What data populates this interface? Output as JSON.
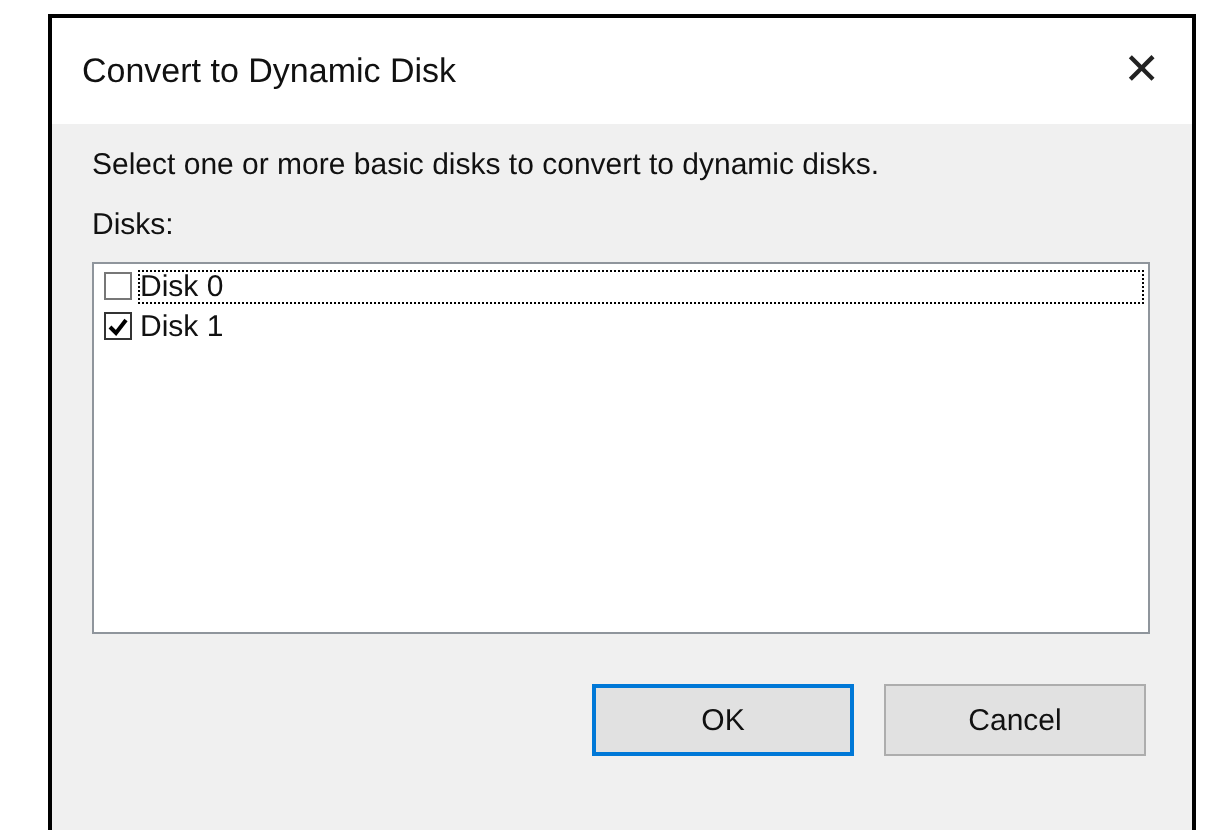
{
  "window": {
    "title": "Convert to Dynamic Disk",
    "close": "✕"
  },
  "instruction": "Select one or more basic disks to convert to dynamic disks.",
  "list_label": "Disks:",
  "disks": [
    {
      "label": "Disk 0",
      "checked": false,
      "focused": true
    },
    {
      "label": "Disk 1",
      "checked": true,
      "focused": false
    }
  ],
  "buttons": [
    {
      "label": "OK",
      "default": true
    },
    {
      "label": "Cancel",
      "default": false
    }
  ]
}
